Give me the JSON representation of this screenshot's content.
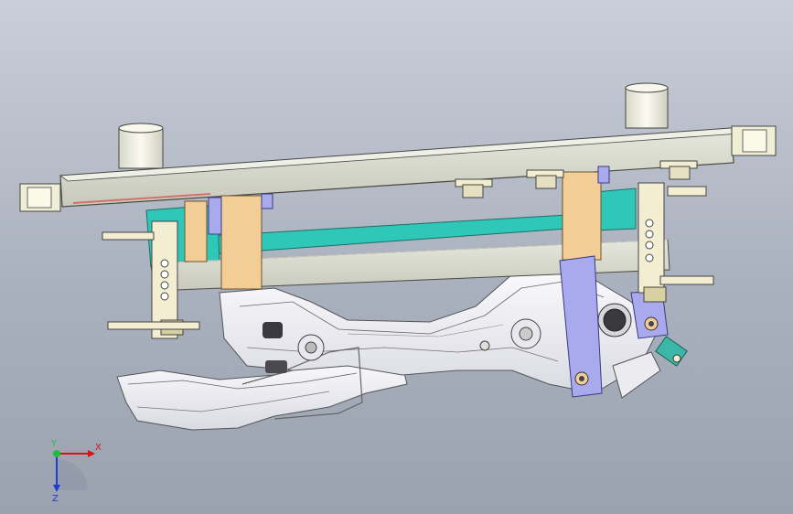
{
  "view": {
    "triad": {
      "x_label": "X",
      "y_label": "Y",
      "z_label": "Z"
    }
  },
  "colors": {
    "background_top": "#c9ced8",
    "background_bottom": "#9aa2b0",
    "beam": "#d9dacd",
    "block_tan": "#f2cd96",
    "rail_cyan": "#2fc8b8",
    "clamp_purple": "#a9a9ee",
    "part_white": "#f4f4f8",
    "pin_cream": "#f3eed2",
    "connector_teal": "#3bb7a8"
  }
}
